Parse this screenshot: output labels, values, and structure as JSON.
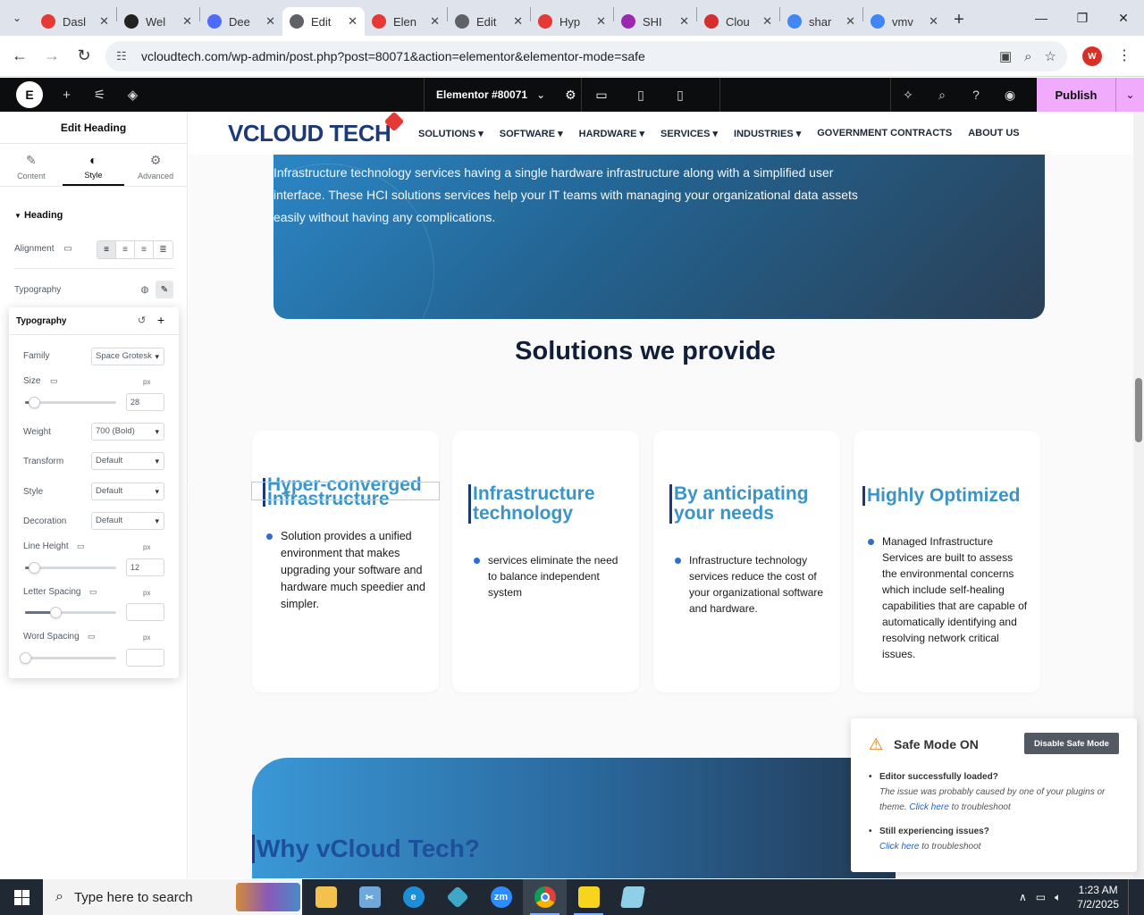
{
  "browser": {
    "tabs": [
      {
        "label": "Dasl",
        "color": "#e53935",
        "active": false
      },
      {
        "label": "Wel",
        "color": "#222222",
        "active": false
      },
      {
        "label": "Dee",
        "color": "#4d6bfe",
        "active": false
      },
      {
        "label": "Edit",
        "color": "#5f6368",
        "active": true
      },
      {
        "label": "Elen",
        "color": "#e53935",
        "active": false
      },
      {
        "label": "Edit",
        "color": "#5f6368",
        "active": false
      },
      {
        "label": "Hyp",
        "color": "#e53935",
        "active": false
      },
      {
        "label": "SHI",
        "color": "#9c27b0",
        "active": false
      },
      {
        "label": "Clou",
        "color": "#d32f2f",
        "active": false
      },
      {
        "label": "shar",
        "color": "#4285f4",
        "active": false
      },
      {
        "label": "vmv",
        "color": "#4285f4",
        "active": false
      }
    ],
    "url": "vcloudtech.com/wp-admin/post.php?post=80071&action=elementor&elementor-mode=safe",
    "profile_initial": "W"
  },
  "editor": {
    "document_title": "Elementor #80071",
    "publish_label": "Publish"
  },
  "panel": {
    "title": "Edit Heading",
    "tabs": {
      "content": "Content",
      "style": "Style",
      "advanced": "Advanced"
    },
    "section": "Heading",
    "alignment_label": "Alignment",
    "typography_label": "Typography",
    "popover": {
      "title": "Typography",
      "family_label": "Family",
      "family_value": "Space Grotesk",
      "size_label": "Size",
      "size_unit": "px",
      "size_value": "28",
      "size_fraction": 0.1,
      "weight_label": "Weight",
      "weight_value": "700 (Bold)",
      "transform_label": "Transform",
      "transform_value": "Default",
      "style_label": "Style",
      "style_value": "Default",
      "decoration_label": "Decoration",
      "decoration_value": "Default",
      "line_height_label": "Line Height",
      "line_height_unit": "px",
      "line_height_value": "12",
      "line_height_fraction": 0.1,
      "letter_spacing_label": "Letter Spacing",
      "letter_spacing_unit": "px",
      "letter_spacing_fraction": 0.33,
      "word_spacing_label": "Word Spacing",
      "word_spacing_unit": "px",
      "word_spacing_fraction": 0.0
    }
  },
  "site": {
    "logo_text": "VCLOUD TECH",
    "nav": [
      "SOLUTIONS ▾",
      "SOFTWARE ▾",
      "HARDWARE ▾",
      "SERVICES ▾",
      "INDUSTRIES ▾",
      "GOVERNMENT CONTRACTS",
      "ABOUT US"
    ],
    "banner_text": "Infrastructure technology services having a single hardware infrastructure along with a simplified user interface. These HCI solutions services help your IT teams with managing your organizational data assets easily without having any complications.",
    "section_title": "Solutions we provide",
    "cards": [
      {
        "heading": "Hyper-converged Infrastructure",
        "bullet": "Solution provides a unified environment that makes upgrading your software and hardware much speedier and simpler."
      },
      {
        "heading": "Infrastructure technology",
        "bullet": "services eliminate the need to balance independent system"
      },
      {
        "heading": "By anticipating your needs",
        "bullet": "Infrastructure technology services reduce the cost of your organizational software and hardware."
      },
      {
        "heading": "Highly Optimized",
        "bullet": "Managed Infrastructure Services are built to assess the environmental concerns which include self-healing capabilities that are capable of automatically identifying and resolving network critical issues."
      }
    ],
    "why_title": "Why vCloud Tech?"
  },
  "safe_mode": {
    "title": "Safe Mode ON",
    "button": "Disable Safe Mode",
    "q1": "Editor successfully loaded?",
    "a1_pre": "The issue was probably caused by one of your plugins or theme.",
    "a1_link": "Click here",
    "a1_post": "to troubleshoot",
    "q2": "Still experiencing issues?",
    "a2_link": "Click here",
    "a2_post": "to troubleshoot"
  },
  "taskbar": {
    "search_placeholder": "Type here to search",
    "time": "1:23 AM",
    "date": "7/2/2025"
  }
}
